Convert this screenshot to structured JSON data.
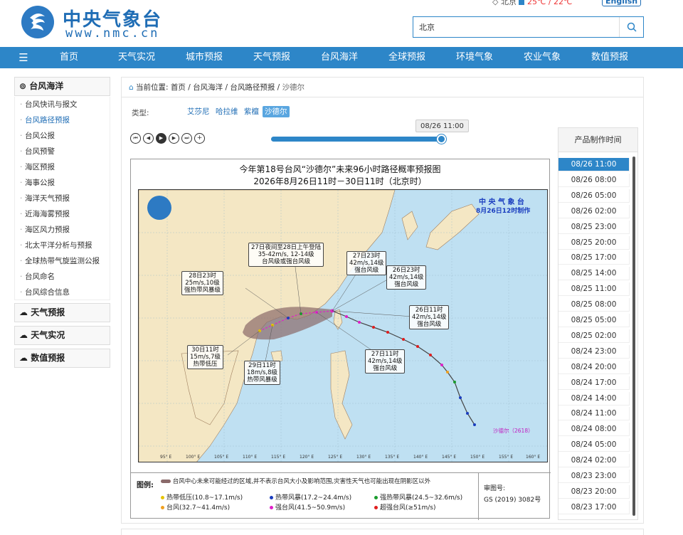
{
  "header": {
    "site_name": "中央气象台",
    "site_url": "www.nmc.cn",
    "weather_city": "北京",
    "weather_temp": "25℃ / 22℃",
    "english_label": "English",
    "search": {
      "value": "北京",
      "placeholder": ""
    }
  },
  "nav": {
    "menu_icon": "menu-icon",
    "items": [
      "首页",
      "天气实况",
      "城市预报",
      "天气预报",
      "台风海洋",
      "全球预报",
      "环境气象",
      "农业气象",
      "数值预报"
    ]
  },
  "sidebar": {
    "section_title": "台风海洋",
    "items": [
      "台风快讯与报文",
      "台风路径预报",
      "台风公报",
      "台风预警",
      "海区预报",
      "海事公报",
      "海洋天气预报",
      "近海海雾预报",
      "海区风力预报",
      "北太平洋分析与预报",
      "全球热带气旋监测公报",
      "台风命名",
      "台风综合信息"
    ],
    "other_sections": [
      "天气预报",
      "天气实况",
      "数值预报"
    ]
  },
  "breadcrumb": {
    "prefix": "当前位置:",
    "items": [
      "首页",
      "台风海洋",
      "台风路径预报",
      "沙德尔"
    ]
  },
  "type_row": {
    "label": "类型:",
    "options": [
      "艾莎尼",
      "哈拉维",
      "紫檀",
      "沙德尔"
    ],
    "selected": "沙德尔"
  },
  "player": {
    "current_time": "08/26 11:00",
    "progress": 1.0
  },
  "product_panel": {
    "title": "产品制作时间",
    "times": [
      "08/26 11:00",
      "08/26 08:00",
      "08/26 05:00",
      "08/26 02:00",
      "08/25 23:00",
      "08/25 20:00",
      "08/25 17:00",
      "08/25 14:00",
      "08/25 11:00",
      "08/25 08:00",
      "08/25 05:00",
      "08/25 02:00",
      "08/24 23:00",
      "08/24 20:00",
      "08/24 17:00",
      "08/24 14:00",
      "08/24 11:00",
      "08/24 08:00",
      "08/24 05:00",
      "08/24 02:00",
      "08/23 23:00",
      "08/23 20:00",
      "08/23 17:00"
    ],
    "selected": "08/26 11:00"
  },
  "figure": {
    "title_line1": "今年第18号台风“沙德尔”未来96小时路径概率预报图",
    "title_line2": "2026年8月26日11时－30日11时（北京时）",
    "stamp_line1": "中 央 气 象 台",
    "stamp_line2": "8月26日12时制作",
    "typhoon_label": "沙德尔（2618）",
    "lon_labels": [
      "95° E",
      "100° E",
      "105° E",
      "110° E",
      "115° E",
      "120° E",
      "125° E",
      "130° E",
      "135° E",
      "140° E",
      "145° E",
      "150° E",
      "155° E",
      "160° E"
    ],
    "annotations": [
      {
        "text": "27日夜间至28日上午登陆\n35-42m/s, 12-14级\n台风级或强台风级"
      },
      {
        "text": "27日23时\n42m/s,14级\n强台风级"
      },
      {
        "text": "26日23时\n42m/s,14级\n强台风级"
      },
      {
        "text": "28日23时\n25m/s,10级\n强热带风暴级"
      },
      {
        "text": "26日11时\n42m/s,14级\n强台风级"
      },
      {
        "text": "30日11时\n15m/s,7级\n热带低压"
      },
      {
        "text": "29日11时\n18m/s,8级\n热带风暴级"
      },
      {
        "text": "27日11时\n42m/s,14级\n强台风级"
      }
    ],
    "legend": {
      "title": "图例:",
      "area_note": "台风中心未来可能经过的区域,并不表示台风大小及影响范围,灾害性天气也可能出现在阴影区以外",
      "items": [
        {
          "label": "热带低压(10.8~17.1m/s)",
          "color": "#e6c300"
        },
        {
          "label": "热带风暴(17.2~24.4m/s)",
          "color": "#1a3dbf"
        },
        {
          "label": "强热带风暴(24.5~32.6m/s)",
          "color": "#1a9b2d"
        },
        {
          "label": "台风(32.7~41.4m/s)",
          "color": "#f0a020"
        },
        {
          "label": "强台风(41.5~50.9m/s)",
          "color": "#e020c8"
        },
        {
          "label": "超强台风(≥51m/s)",
          "color": "#e01e1e"
        }
      ],
      "review_label": "审图号:",
      "review_no": "GS (2019) 3082号"
    }
  },
  "colors": {
    "brand": "#2d86c8",
    "nav_bg": "#2d86c8",
    "logo": "#1f6db5",
    "active": "#2d86c8"
  }
}
